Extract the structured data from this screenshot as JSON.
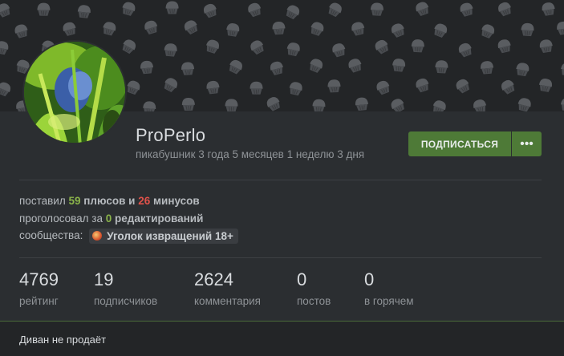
{
  "profile": {
    "username": "ProPerlo",
    "tenure": "пикабушник 3 года 5 месяцев 1 неделю 3 дня"
  },
  "actions": {
    "subscribe_label": "ПОДПИСАТЬСЯ",
    "more_label": "•••"
  },
  "votes": {
    "prefix": "поставил",
    "pluses": "59",
    "pluses_word": "плюсов",
    "and": "и",
    "minuses": "26",
    "minuses_word": "минусов"
  },
  "edits": {
    "prefix": "проголосовал за",
    "count": "0",
    "word": "редактирований"
  },
  "communities": {
    "label": "сообщества:",
    "items": [
      "Уголок извращений 18+"
    ]
  },
  "stats": [
    {
      "value": "4769",
      "label": "рейтинг"
    },
    {
      "value": "19",
      "label": "подписчиков"
    },
    {
      "value": "2624",
      "label": "комментария"
    },
    {
      "value": "0",
      "label": "постов"
    },
    {
      "value": "0",
      "label": "в горячем"
    }
  ],
  "note": {
    "value": "Диван не продаёт"
  },
  "colors": {
    "accent_green": "#4e7a37",
    "plus_green": "#8ab34a",
    "minus_red": "#e0524a",
    "background": "#2b2e31"
  },
  "icons": {
    "banner_pattern": "cupcake-pattern-icon",
    "community": "community-avatar-icon"
  }
}
